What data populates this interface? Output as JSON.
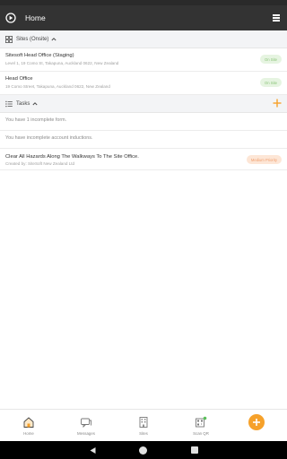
{
  "header": {
    "title": "Home"
  },
  "sites": {
    "label": "Sites (Onsite)",
    "items": [
      {
        "name": "Sitesoft Head Office (Staging)",
        "address": "Level 1, 19 Como St, Takapuna, Auckland 0622, New Zealand",
        "badge": "On Site"
      },
      {
        "name": "Head Office",
        "address": "19 Como Street, Takapuna, Auckland 0622, New Zealand",
        "badge": "On Site"
      }
    ]
  },
  "tasks": {
    "label": "Tasks",
    "items": [
      {
        "text": "You have 1 incomplete form."
      },
      {
        "text": "You have incomplete account inductions."
      }
    ],
    "hazard": {
      "title": "Clear All Hazards Along The Walkways To The Site Office.",
      "subtitle": "Created by: SiteSoft New Zealand Ltd",
      "badge": "Medium Priority"
    }
  },
  "bottom_nav": {
    "items": [
      {
        "label": "Home",
        "icon": "home-icon"
      },
      {
        "label": "Messages",
        "icon": "messages-icon"
      },
      {
        "label": "Sites",
        "icon": "building-icon"
      },
      {
        "label": "Scan QR",
        "icon": "qr-code-icon"
      }
    ]
  },
  "colors": {
    "app_bar": "#333333",
    "accent": "#f6a12a",
    "onsite_badge_bg": "#e6f4e1",
    "onsite_badge_text": "#8cc47a",
    "priority_badge_bg": "#fde6d6",
    "priority_badge_text": "#f0a070"
  }
}
